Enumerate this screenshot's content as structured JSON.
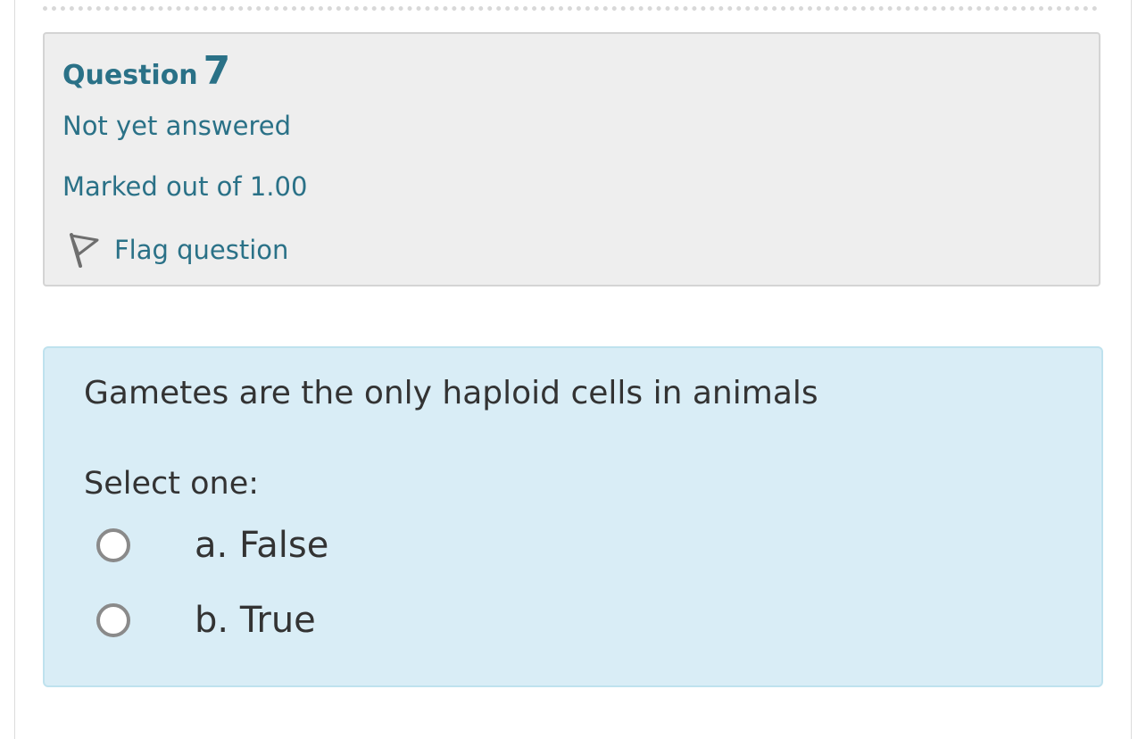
{
  "question_info": {
    "label": "Question",
    "number": "7",
    "state": "Not yet answered",
    "grade": "Marked out of 1.00",
    "flag_label": "Flag question",
    "flag_icon": "flag-icon"
  },
  "question": {
    "text": "Gametes are the only haploid cells in animals",
    "prompt": "Select one:",
    "options": [
      {
        "label": "a. False",
        "selected": false
      },
      {
        "label": "b. True",
        "selected": false
      }
    ]
  },
  "colors": {
    "accent_text": "#2a7187",
    "info_background": "#eeeeee",
    "content_background": "#d9edf6",
    "content_border": "#bfe2ee"
  }
}
